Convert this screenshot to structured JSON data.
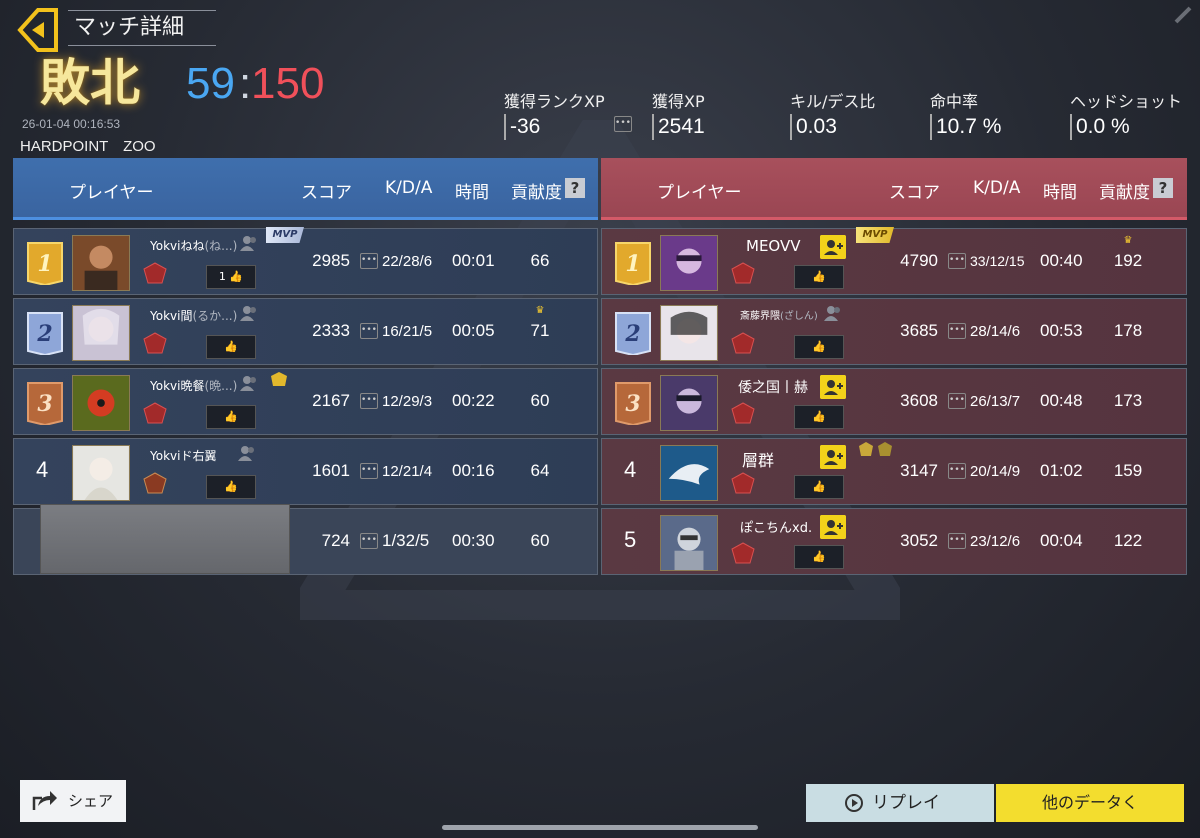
{
  "header": {
    "title": "マッチ詳細",
    "result": "敗北",
    "score_blue": "59",
    "score_sep": ":",
    "score_red": "150",
    "datetime": "26-01-04 00:16:53",
    "mode": "HARDPOINT　ZOO"
  },
  "stats": [
    {
      "label": "獲得ランクXP",
      "value": "-36"
    },
    {
      "label": "獲得XP",
      "value": "2541"
    },
    {
      "label": "キル/デス比",
      "value": "0.03"
    },
    {
      "label": "命中率",
      "value": "10.7 %"
    },
    {
      "label": "ヘッドショット",
      "value": "0.0 %"
    }
  ],
  "table_headers": {
    "player": "プレイヤー",
    "score": "スコア",
    "kda": "K/D/A",
    "time": "時間",
    "contribution": "貢献度",
    "help": "?"
  },
  "blue_team": [
    {
      "rank": "1",
      "name": "Yokviねね",
      "sub": "(ね...)",
      "likes": "1",
      "score": "2985",
      "kda": "22/28/6",
      "time": "00:01",
      "contribution": "66",
      "mvp": "MVP"
    },
    {
      "rank": "2",
      "name": "Yokvi間",
      "sub": "(るか...)",
      "likes": "",
      "score": "2333",
      "kda": "16/21/5",
      "time": "00:05",
      "contribution": "71",
      "crown": "♛"
    },
    {
      "rank": "3",
      "name": "Yokvi晩餐",
      "sub": "(晩...)",
      "likes": "",
      "score": "2167",
      "kda": "12/29/3",
      "time": "00:22",
      "contribution": "60"
    },
    {
      "rank": "4",
      "name": "Yokviド右翼",
      "sub": "",
      "likes": "",
      "score": "1601",
      "kda": "12/21/4",
      "time": "00:16",
      "contribution": "64"
    },
    {
      "rank": "",
      "name": "",
      "sub": "",
      "likes": "",
      "score": "724",
      "kda": "1/32/5",
      "time": "00:30",
      "contribution": "60"
    }
  ],
  "red_team": [
    {
      "rank": "1",
      "name": "MEOVV",
      "sub": "",
      "score": "4790",
      "kda": "33/12/15",
      "time": "00:40",
      "contribution": "192",
      "mvp": "MVP",
      "crown": "♛"
    },
    {
      "rank": "2",
      "name": "斎藤界隈",
      "sub": "(ざしん)",
      "score": "3685",
      "kda": "28/14/6",
      "time": "00:53",
      "contribution": "178"
    },
    {
      "rank": "3",
      "name": "倭之国丨赫",
      "sub": "",
      "score": "3608",
      "kda": "26/13/7",
      "time": "00:48",
      "contribution": "173"
    },
    {
      "rank": "4",
      "name": "層群",
      "sub": "",
      "score": "3147",
      "kda": "20/14/9",
      "time": "01:02",
      "contribution": "159"
    },
    {
      "rank": "5",
      "name": "ぽこちんxd.",
      "sub": "",
      "score": "3052",
      "kda": "23/12/6",
      "time": "00:04",
      "contribution": "122"
    }
  ],
  "footer": {
    "share": "シェア",
    "replay": "リプレイ",
    "other_data": "他のデータく"
  },
  "colors": {
    "blue": "#4aa7f2",
    "red": "#f0505a",
    "gold": "#f6e79c",
    "accent_yellow": "#f3dd2e"
  },
  "icons": [
    "back-arrow-icon",
    "like-icon",
    "add-friend-icon",
    "friend-icon",
    "rank-emblem-icon",
    "share-icon",
    "replay-icon",
    "crown-icon"
  ]
}
